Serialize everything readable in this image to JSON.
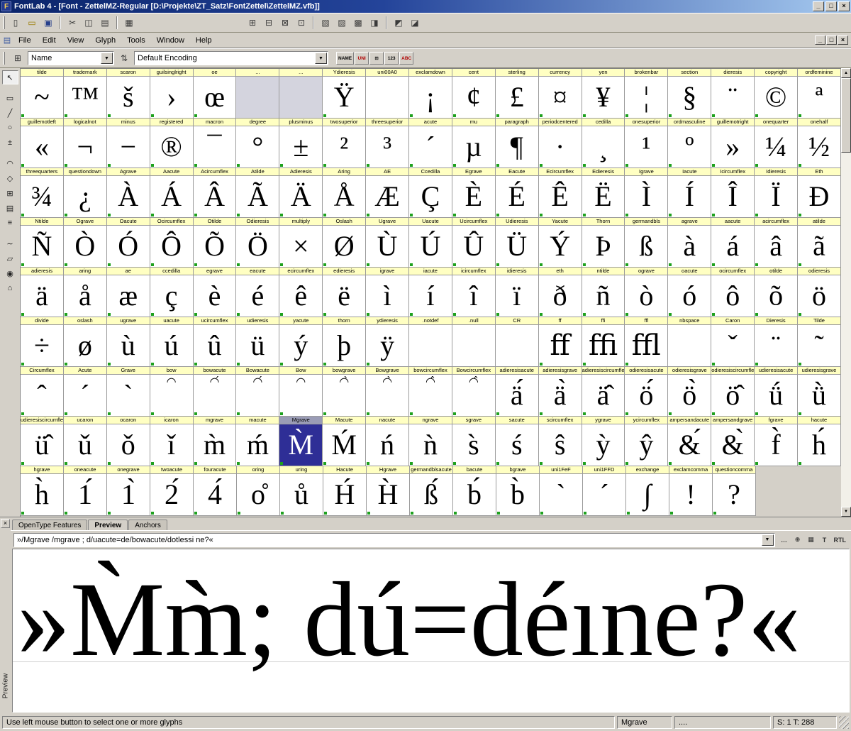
{
  "window": {
    "title": "FontLab 4 - [Font - ZettelMZ-Regular [D:\\Projekte\\ZT_Satz\\FontZettel\\ZettelMZ.vfb]]",
    "icon_letter": "F",
    "controls": {
      "minimize": "_",
      "maximize": "□",
      "close": "×"
    },
    "mdi": {
      "minimize": "_",
      "restore": "□",
      "close": "×"
    }
  },
  "menu": {
    "items": [
      "File",
      "Edit",
      "View",
      "Glyph",
      "Tools",
      "Window",
      "Help"
    ]
  },
  "icons": {
    "down_arrow": "▼",
    "up_arrow": "▲",
    "document": "▤"
  },
  "toolbar_main": {
    "items": [
      {
        "n": "new-icon",
        "g": "▯"
      },
      {
        "n": "open-icon",
        "g": "▭",
        "c": "#9a7b00"
      },
      {
        "n": "save-icon",
        "g": "▣",
        "c": "#27408b"
      },
      {
        "sep": 1
      },
      {
        "n": "cut-icon",
        "g": "✂"
      },
      {
        "n": "copy-icon",
        "g": "◫"
      },
      {
        "n": "paste-icon",
        "g": "▤"
      },
      {
        "sep": 1
      },
      {
        "n": "print-icon",
        "g": "▦"
      },
      {
        "gap": 150
      },
      {
        "n": "font-window-icon",
        "g": "⊞"
      },
      {
        "n": "metrics-window-icon",
        "g": "⊟"
      },
      {
        "n": "classes-panel-icon",
        "g": "⊠"
      },
      {
        "n": "transform-panel-icon",
        "g": "⊡"
      },
      {
        "sep": 1
      },
      {
        "n": "glyph-window-icon",
        "g": "▧"
      },
      {
        "n": "preview-panel-icon",
        "g": "▨"
      },
      {
        "n": "panels-icon",
        "g": "▩"
      },
      {
        "n": "options-icon",
        "g": "◨"
      },
      {
        "sep": 1
      },
      {
        "n": "macro-icon",
        "g": "◩"
      },
      {
        "n": "info-icon",
        "g": "◪"
      }
    ]
  },
  "toolbar_top": {
    "map_button": "⊞",
    "caption_mode": "Name",
    "sort_icon": "⇅",
    "encoding": "Default Encoding",
    "modes": [
      {
        "n": "caption-names-button",
        "t": "NAME"
      },
      {
        "n": "caption-unicode-button",
        "t": "UNI",
        "c": "#b00000"
      },
      {
        "n": "caption-table-button",
        "g": "⊞"
      },
      {
        "n": "caption-codepage-button",
        "t": "123"
      },
      {
        "n": "caption-ansi-button",
        "t": "ABC",
        "c": "#b00000"
      }
    ]
  },
  "tools_left": {
    "items": [
      {
        "n": "edit-tool",
        "g": "↖",
        "active": 1
      },
      {
        "n": "eraser-tool",
        "g": "▭",
        "gap": 1
      },
      {
        "n": "knife-tool",
        "g": "╱"
      },
      {
        "n": "magnify-tool",
        "g": "○"
      },
      {
        "n": "meter-tool",
        "g": "±"
      },
      {
        "n": "contour-tool",
        "g": "◠",
        "gap": 1
      },
      {
        "n": "node-tool",
        "g": "◇"
      },
      {
        "n": "mesh-tool",
        "g": "⊞"
      },
      {
        "n": "table-tool",
        "g": "▤"
      },
      {
        "n": "align-tool",
        "g": "≡"
      },
      {
        "n": "wave-tool",
        "g": "∼",
        "gap": 1
      },
      {
        "n": "rect-tool",
        "g": "▱"
      },
      {
        "n": "ellipse-tool",
        "g": "◉"
      },
      {
        "n": "hand-tool",
        "g": "⌂"
      }
    ]
  },
  "grid": {
    "rows": [
      [
        {
          "n": "tilde",
          "g": "~"
        },
        {
          "n": "trademark",
          "g": "™"
        },
        {
          "n": "scaron",
          "g": "š"
        },
        {
          "n": "guilsinglright",
          "g": "›"
        },
        {
          "n": "oe",
          "g": "œ"
        },
        {
          "n": "...",
          "s": "gray"
        },
        {
          "n": "...",
          "s": "gray"
        },
        {
          "n": "Ydieresis",
          "g": "Ÿ"
        },
        {
          "n": "uni00A0",
          "g": ""
        },
        {
          "n": "exclamdown",
          "g": "¡"
        },
        {
          "n": "cent",
          "g": "¢"
        },
        {
          "n": "sterling",
          "g": "£"
        },
        {
          "n": "currency",
          "g": "¤"
        },
        {
          "n": "yen",
          "g": "¥"
        },
        {
          "n": "brokenbar",
          "g": "¦"
        },
        {
          "n": "section",
          "g": "§"
        },
        {
          "n": "dieresis",
          "g": "¨"
        },
        {
          "n": "copyright",
          "g": "©"
        },
        {
          "n": "ordfeminine",
          "g": "ª"
        }
      ],
      [
        {
          "n": "guillemotleft",
          "g": "«"
        },
        {
          "n": "logicalnot",
          "g": "¬"
        },
        {
          "n": "minus",
          "g": "−"
        },
        {
          "n": "registered",
          "g": "®"
        },
        {
          "n": "macron",
          "g": "¯"
        },
        {
          "n": "degree",
          "g": "°"
        },
        {
          "n": "plusminus",
          "g": "±"
        },
        {
          "n": "twosuperior",
          "g": "²"
        },
        {
          "n": "threesuperior",
          "g": "³"
        },
        {
          "n": "acute",
          "g": "´"
        },
        {
          "n": "mu",
          "g": "µ"
        },
        {
          "n": "paragraph",
          "g": "¶"
        },
        {
          "n": "periodcentered",
          "g": "·"
        },
        {
          "n": "cedilla",
          "g": "¸"
        },
        {
          "n": "onesuperior",
          "g": "¹"
        },
        {
          "n": "ordmasculine",
          "g": "º"
        },
        {
          "n": "guillemotright",
          "g": "»"
        },
        {
          "n": "onequarter",
          "g": "¼"
        },
        {
          "n": "onehalf",
          "g": "½"
        }
      ],
      [
        {
          "n": "threequarters",
          "g": "¾"
        },
        {
          "n": "questiondown",
          "g": "¿"
        },
        {
          "n": "Agrave",
          "g": "À"
        },
        {
          "n": "Aacute",
          "g": "Á"
        },
        {
          "n": "Acircumflex",
          "g": "Â"
        },
        {
          "n": "Atilde",
          "g": "Ã"
        },
        {
          "n": "Adieresis",
          "g": "Ä"
        },
        {
          "n": "Aring",
          "g": "Å"
        },
        {
          "n": "AE",
          "g": "Æ"
        },
        {
          "n": "Ccedilla",
          "g": "Ç"
        },
        {
          "n": "Egrave",
          "g": "È"
        },
        {
          "n": "Eacute",
          "g": "É"
        },
        {
          "n": "Ecircumflex",
          "g": "Ê"
        },
        {
          "n": "Edieresis",
          "g": "Ë"
        },
        {
          "n": "Igrave",
          "g": "Ì"
        },
        {
          "n": "Iacute",
          "g": "Í"
        },
        {
          "n": "Icircumflex",
          "g": "Î"
        },
        {
          "n": "Idieresis",
          "g": "Ï"
        },
        {
          "n": "Eth",
          "g": "Ð"
        }
      ],
      [
        {
          "n": "Ntilde",
          "g": "Ñ"
        },
        {
          "n": "Ograve",
          "g": "Ò"
        },
        {
          "n": "Oacute",
          "g": "Ó"
        },
        {
          "n": "Ocircumflex",
          "g": "Ô"
        },
        {
          "n": "Otilde",
          "g": "Õ"
        },
        {
          "n": "Odieresis",
          "g": "Ö"
        },
        {
          "n": "multiply",
          "g": "×"
        },
        {
          "n": "Oslash",
          "g": "Ø"
        },
        {
          "n": "Ugrave",
          "g": "Ù"
        },
        {
          "n": "Uacute",
          "g": "Ú"
        },
        {
          "n": "Ucircumflex",
          "g": "Û"
        },
        {
          "n": "Udieresis",
          "g": "Ü"
        },
        {
          "n": "Yacute",
          "g": "Ý"
        },
        {
          "n": "Thorn",
          "g": "Þ"
        },
        {
          "n": "germandbls",
          "g": "ß"
        },
        {
          "n": "agrave",
          "g": "à"
        },
        {
          "n": "aacute",
          "g": "á"
        },
        {
          "n": "acircumflex",
          "g": "â"
        },
        {
          "n": "atilde",
          "g": "ã"
        }
      ],
      [
        {
          "n": "adieresis",
          "g": "ä"
        },
        {
          "n": "aring",
          "g": "å"
        },
        {
          "n": "ae",
          "g": "æ"
        },
        {
          "n": "ccedilla",
          "g": "ç"
        },
        {
          "n": "egrave",
          "g": "è"
        },
        {
          "n": "eacute",
          "g": "é"
        },
        {
          "n": "ecircumflex",
          "g": "ê"
        },
        {
          "n": "edieresis",
          "g": "ë"
        },
        {
          "n": "igrave",
          "g": "ì"
        },
        {
          "n": "iacute",
          "g": "í"
        },
        {
          "n": "icircumflex",
          "g": "î"
        },
        {
          "n": "idieresis",
          "g": "ï"
        },
        {
          "n": "eth",
          "g": "ð"
        },
        {
          "n": "ntilde",
          "g": "ñ"
        },
        {
          "n": "ograve",
          "g": "ò"
        },
        {
          "n": "oacute",
          "g": "ó"
        },
        {
          "n": "ocircumflex",
          "g": "ô"
        },
        {
          "n": "otilde",
          "g": "õ"
        },
        {
          "n": "odieresis",
          "g": "ö"
        }
      ],
      [
        {
          "n": "divide",
          "g": "÷"
        },
        {
          "n": "oslash",
          "g": "ø"
        },
        {
          "n": "ugrave",
          "g": "ù"
        },
        {
          "n": "uacute",
          "g": "ú"
        },
        {
          "n": "ucircumflex",
          "g": "û"
        },
        {
          "n": "udieresis",
          "g": "ü"
        },
        {
          "n": "yacute",
          "g": "ý"
        },
        {
          "n": "thorn",
          "g": "þ"
        },
        {
          "n": "ydieresis",
          "g": "ÿ"
        },
        {
          "n": ".notdef",
          "g": ""
        },
        {
          "n": ".null",
          "g": ""
        },
        {
          "n": "CR",
          "g": ""
        },
        {
          "n": "ff",
          "g": "ﬀ"
        },
        {
          "n": "ffi",
          "g": "ﬃ"
        },
        {
          "n": "ffl",
          "g": "ﬄ"
        },
        {
          "n": "nbspace",
          "g": ""
        },
        {
          "n": "Caron",
          "g": "ˇ"
        },
        {
          "n": "Dieresis",
          "g": "¨"
        },
        {
          "n": "Tilde",
          "g": "˜"
        }
      ],
      [
        {
          "n": "Circumflex",
          "g": "ˆ"
        },
        {
          "n": "Acute",
          "g": "´"
        },
        {
          "n": "Grave",
          "g": "`"
        },
        {
          "n": "bow",
          "g": "◠",
          "sm": 1
        },
        {
          "n": "bowacute",
          "g": "◠́",
          "sm": 1
        },
        {
          "n": "Bowacute",
          "g": "◠́",
          "sm": 1
        },
        {
          "n": "Bow",
          "g": "◠",
          "sm": 1
        },
        {
          "n": "bowgrave",
          "g": "◠̀",
          "sm": 1
        },
        {
          "n": "Bowgrave",
          "g": "◠̀",
          "sm": 1
        },
        {
          "n": "bowcircumflex",
          "g": "◠̂",
          "sm": 1
        },
        {
          "n": "Bowcircumflex",
          "g": "◠̂",
          "sm": 1
        },
        {
          "n": "adieresisacute",
          "g": "ä́"
        },
        {
          "n": "adieresisgrave",
          "g": "ä̀"
        },
        {
          "n": "adieresiscircumflex",
          "g": "ä̂"
        },
        {
          "n": "odieresisacute",
          "g": "ö́"
        },
        {
          "n": "odieresisgrave",
          "g": "ö̀"
        },
        {
          "n": "odieresiscircumflex",
          "g": "ö̂"
        },
        {
          "n": "udieresisacute",
          "g": "ǘ"
        },
        {
          "n": "udieresisgrave",
          "g": "ǜ"
        }
      ],
      [
        {
          "n": "udieresiscircumflex",
          "g": "ü̂"
        },
        {
          "n": "ucaron",
          "g": "ǔ"
        },
        {
          "n": "ocaron",
          "g": "ǒ"
        },
        {
          "n": "icaron",
          "g": "ǐ"
        },
        {
          "n": "mgrave",
          "g": "m̀"
        },
        {
          "n": "macute",
          "g": "ḿ"
        },
        {
          "n": "Mgrave",
          "g": "M̀",
          "s": "sel"
        },
        {
          "n": "Macute",
          "g": "Ḿ"
        },
        {
          "n": "nacute",
          "g": "ń"
        },
        {
          "n": "ngrave",
          "g": "ǹ"
        },
        {
          "n": "sgrave",
          "g": "s̀"
        },
        {
          "n": "sacute",
          "g": "ś"
        },
        {
          "n": "scircumflex",
          "g": "ŝ"
        },
        {
          "n": "ygrave",
          "g": "ỳ"
        },
        {
          "n": "ycircumflex",
          "g": "ŷ"
        },
        {
          "n": "ampersandacute",
          "g": "&́"
        },
        {
          "n": "ampersandgrave",
          "g": "&̀"
        },
        {
          "n": "fgrave",
          "g": "f̀"
        },
        {
          "n": "hacute",
          "g": "h́"
        }
      ],
      [
        {
          "n": "hgrave",
          "g": "h̀"
        },
        {
          "n": "oneacute",
          "g": "1́"
        },
        {
          "n": "onegrave",
          "g": "1̀"
        },
        {
          "n": "twoacute",
          "g": "2́"
        },
        {
          "n": "fouracute",
          "g": "4́"
        },
        {
          "n": "oring",
          "g": "o̊"
        },
        {
          "n": "uring",
          "g": "ů"
        },
        {
          "n": "Hacute",
          "g": "H́"
        },
        {
          "n": "Hgrave",
          "g": "H̀"
        },
        {
          "n": "germandblsacute",
          "g": "ß́"
        },
        {
          "n": "bacute",
          "g": "b́"
        },
        {
          "n": "bgrave",
          "g": "b̀"
        },
        {
          "n": "uni1FeF",
          "g": "`"
        },
        {
          "n": "uni1FFD",
          "g": "´"
        },
        {
          "n": "exchange",
          "g": "∫"
        },
        {
          "n": "exclamcomma",
          "g": "!"
        },
        {
          "n": "questioncomma",
          "g": "?"
        },
        {
          "s": "none"
        },
        {
          "s": "none"
        }
      ]
    ]
  },
  "panel": {
    "close_label": "×",
    "side_label": "Preview",
    "tabs": [
      {
        "label": "OpenType Features"
      },
      {
        "label": "Preview",
        "active": true
      },
      {
        "label": "Anchors"
      }
    ]
  },
  "preview": {
    "input_value": "»/Mgrave /mgrave ; d/uacute=de/bowacute/dotlessi ne?«",
    "display_text": "»M̀m̀; dú=déıne?«",
    "buttons": [
      {
        "n": "preview-options-button",
        "t": "…"
      },
      {
        "n": "preview-zoom-button",
        "g": "⊕"
      },
      {
        "n": "preview-print-button",
        "g": "▦"
      },
      {
        "n": "preview-features-button",
        "t": "T"
      },
      {
        "n": "preview-rtl-button",
        "t": "RTL"
      }
    ]
  },
  "status": {
    "hint": "Use left mouse button to select one or more glyphs",
    "glyph_name": "Mgrave",
    "dots": "....",
    "counts": "S: 1 T: 288"
  }
}
